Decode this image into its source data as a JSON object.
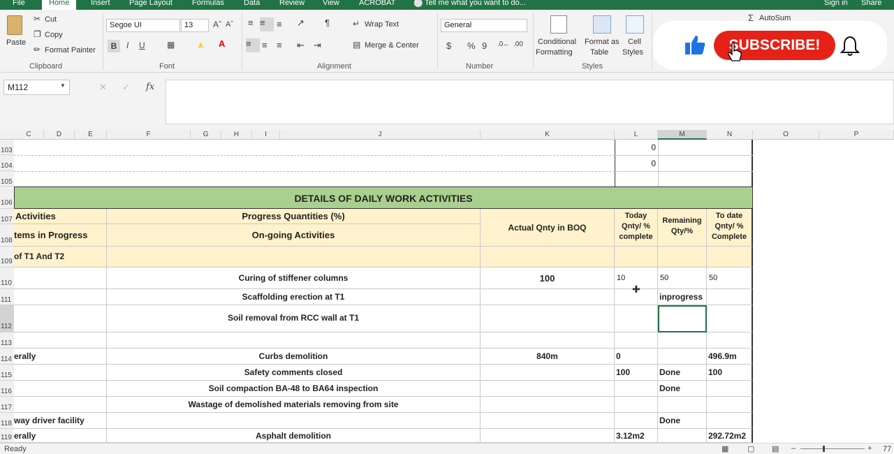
{
  "menu": {
    "file": "File",
    "tabs": [
      "Home",
      "Insert",
      "Page Layout",
      "Formulas",
      "Data",
      "Review",
      "View",
      "ACROBAT"
    ],
    "tell_me": "Tell me what you want to do...",
    "sign_in": "Sign in",
    "share": "Share"
  },
  "ribbon": {
    "clipboard": {
      "paste": "Paste",
      "cut": "Cut",
      "copy": "Copy",
      "format_painter": "Format Painter",
      "group": "Clipboard"
    },
    "font": {
      "name": "Segoe UI",
      "size": "13",
      "bold": "B",
      "italic": "I",
      "underline": "U",
      "group": "Font"
    },
    "alignment": {
      "wrap_text": "Wrap Text",
      "merge_center": "Merge & Center",
      "group": "Alignment"
    },
    "number": {
      "format": "General",
      "currency": "$",
      "percent": "%",
      "comma": "9",
      "group": "Number"
    },
    "styles": {
      "conditional": "Conditional",
      "formatting": "Formatting",
      "format_as": "Format as",
      "table": "Table",
      "cell": "Cell",
      "cell_styles": "Styles",
      "group": "Styles"
    },
    "editing": {
      "autosum": "AutoSum"
    }
  },
  "overlay": {
    "subscribe": "SUBSCRIBE!"
  },
  "formula_bar": {
    "name_box": "M112",
    "fx": "fx"
  },
  "columns": [
    "C",
    "D",
    "E",
    "F",
    "G",
    "H",
    "I",
    "J",
    "K",
    "L",
    "M",
    "N",
    "O",
    "P"
  ],
  "rows": [
    "103",
    "104",
    "105",
    "106",
    "107",
    "108",
    "109",
    "110",
    "111",
    "112",
    "113",
    "114",
    "115",
    "116",
    "117",
    "118",
    "119"
  ],
  "sheet": {
    "zero_103": "0",
    "zero_104": "0",
    "banner": "DETAILS OF DAILY WORK ACTIVITIES",
    "activities": "Activities",
    "progress_quantities": "Progress Quantities (%)",
    "actual_qnty": "Actual Qnty in BOQ",
    "today_qnty": "Today Qnty/ % complete",
    "remaining_qty": "Remaining Qty/%",
    "to_date_qnty": "To date Qnty/ % Complete",
    "items_in_progress": "tems in Progress",
    "ongoing": "On-going Activities",
    "t1_t2": "of T1 And T2",
    "r110_desc": "Curing of stiffener columns",
    "r110_boq": "100",
    "r110_today": "10",
    "r110_rem": "50",
    "r110_todate": "50",
    "r111_desc": "Scaffolding erection at T1",
    "r111_rem": "inprogress",
    "r112_desc": "Soil removal from RCC wall at T1",
    "r114_a": "erally",
    "r114_desc": "Curbs demolition",
    "r114_boq": "840m",
    "r114_today": "0",
    "r114_todate": "496.9m",
    "r115_desc": "Safety comments closed",
    "r115_today": "100",
    "r115_rem": "Done",
    "r115_todate": "100",
    "r116_desc": "Soil compaction BA-48 to BA64 inspection",
    "r116_rem": "Done",
    "r117_desc": "Wastage of  demolished materials removing from site",
    "r118_a": "way driver facility",
    "r118_rem": "Done",
    "r119_a": "erally",
    "r119_desc": "Asphalt demolition",
    "r119_today": "3.12m2",
    "r119_todate": "292.72m2"
  },
  "status": {
    "ready": "Ready",
    "zoom": "77"
  },
  "colors": {
    "excel_green": "#217346",
    "banner_green": "#a9d08e",
    "header_beige": "#fff2cc",
    "subscribe_red": "#e62117",
    "like_blue": "#1a73e8"
  }
}
